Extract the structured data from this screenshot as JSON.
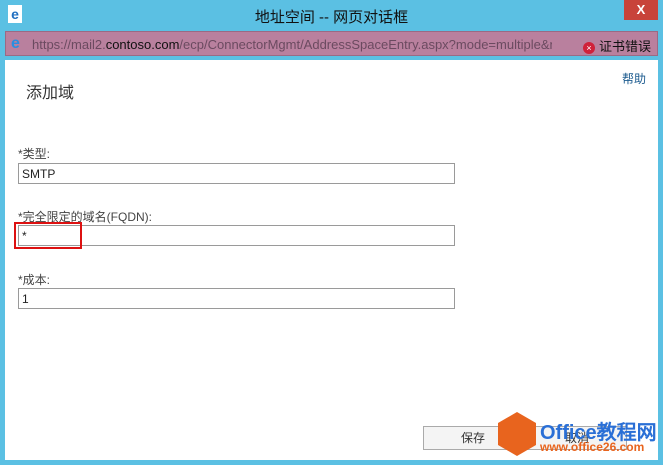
{
  "window": {
    "title": "地址空间 -- 网页对话框",
    "close": "X"
  },
  "address_bar": {
    "url_prefix": "https://mail2.",
    "url_domain": "contoso.com",
    "url_rest": "/ecp/ConnectorMgmt/AddressSpaceEntry.aspx?mode=multiple&ne",
    "cert_error": "证书错误"
  },
  "page": {
    "help": "帮助",
    "heading": "添加域",
    "fields": [
      {
        "label": "*类型:",
        "value": "SMTP"
      },
      {
        "label": "*完全限定的域名(FQDN):",
        "value": "*"
      },
      {
        "label": "*成本:",
        "value": "1"
      }
    ],
    "save": "保存",
    "cancel": "取消"
  },
  "watermark": {
    "brand": "Office教程网",
    "site": "www.office26.com"
  }
}
